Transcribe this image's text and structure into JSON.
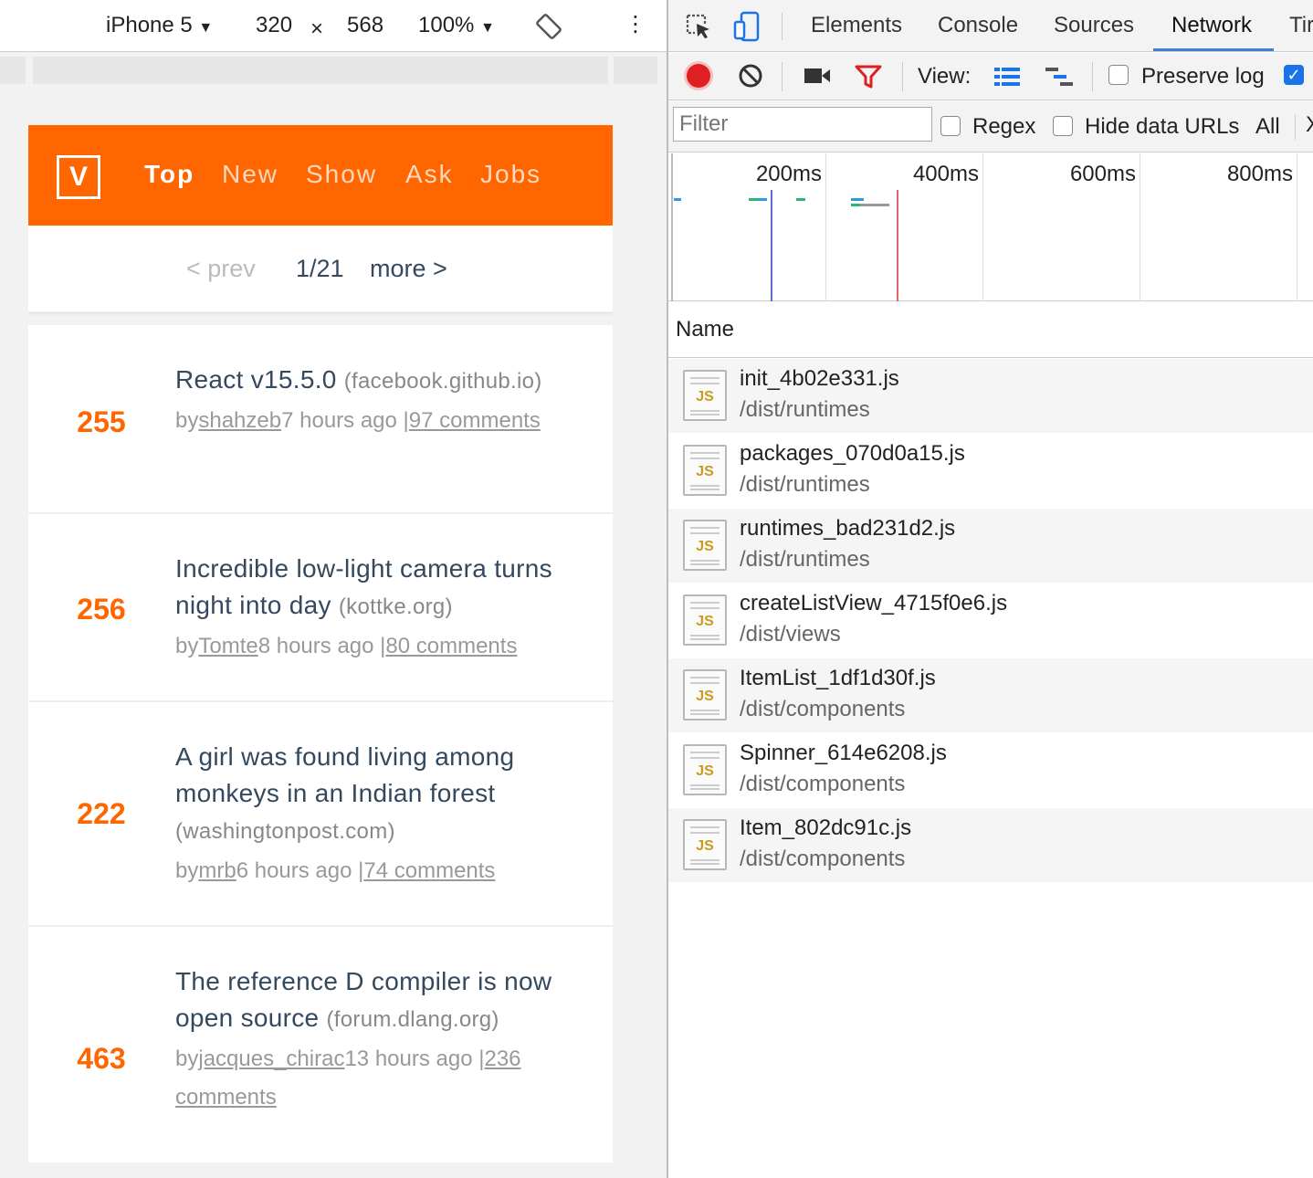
{
  "device_toolbar": {
    "device": "iPhone 5",
    "width": "320",
    "times": "×",
    "height": "568",
    "zoom": "100%",
    "more": "⋮"
  },
  "hn": {
    "logo": "V",
    "nav": [
      "Top",
      "New",
      "Show",
      "Ask",
      "Jobs"
    ],
    "pager": {
      "prev": "< prev",
      "page": "1/21",
      "more": "more >"
    },
    "items": [
      {
        "score": "255",
        "title": "React v15.5.0",
        "host": "(facebook.github.io)",
        "by": "by",
        "user": "shahzeb",
        "time": "7 hours ago |",
        "comments": "97 comments"
      },
      {
        "score": "256",
        "title": "Incredible low-light camera turns night into day",
        "host": "(kottke.org)",
        "by": "by",
        "user": "Tomte",
        "time": "8 hours ago |",
        "comments": "80 comments"
      },
      {
        "score": "222",
        "title": "A girl was found living among monkeys in an Indian forest",
        "host": "(washingtonpost.com)",
        "by": "by",
        "user": "mrb",
        "time": "6 hours ago |",
        "comments": "74 comments"
      },
      {
        "score": "463",
        "title": "The reference D compiler is now open source",
        "host": "(forum.dlang.org)",
        "by": "by",
        "user": "jacques_chirac",
        "time": "13 hours ago |",
        "comments": "236 comments"
      }
    ]
  },
  "devtools": {
    "tabs": [
      "Elements",
      "Console",
      "Sources",
      "Network",
      "Tir"
    ],
    "active_tab": "Network",
    "toolbar": {
      "view_label": "View:",
      "preserve_log": "Preserve log"
    },
    "filter": {
      "placeholder": "Filter",
      "regex": "Regex",
      "hide_data_urls": "Hide data URLs",
      "all": "All"
    },
    "timeline_ticks": [
      "200ms",
      "400ms",
      "600ms",
      "800ms"
    ],
    "name_header": "Name",
    "requests": [
      {
        "name": "init_4b02e331.js",
        "path": "/dist/runtimes"
      },
      {
        "name": "packages_070d0a15.js",
        "path": "/dist/runtimes"
      },
      {
        "name": "runtimes_bad231d2.js",
        "path": "/dist/runtimes"
      },
      {
        "name": "createListView_4715f0e6.js",
        "path": "/dist/views"
      },
      {
        "name": "ItemList_1df1d30f.js",
        "path": "/dist/components"
      },
      {
        "name": "Spinner_614e6208.js",
        "path": "/dist/components"
      },
      {
        "name": "Item_802dc91c.js",
        "path": "/dist/components"
      }
    ],
    "file_icon_label": "JS"
  },
  "colors": {
    "hn_orange": "#ff6600",
    "record_red": "#e02020",
    "accent_blue": "#1a73e8"
  }
}
